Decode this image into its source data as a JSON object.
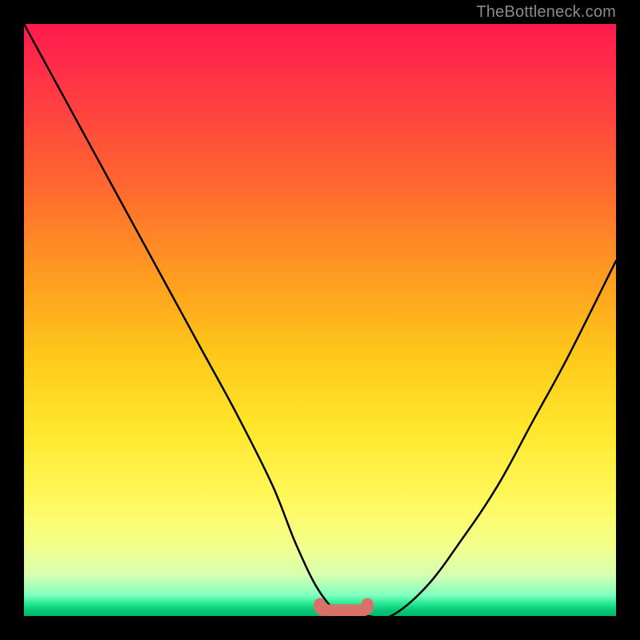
{
  "watermark": "TheBottleneck.com",
  "colors": {
    "curve_stroke": "#000000",
    "valley_stroke": "#d9716a",
    "background": "#000000"
  },
  "chart_data": {
    "type": "line",
    "title": "",
    "xlabel": "",
    "ylabel": "",
    "xlim": [
      0,
      100
    ],
    "ylim": [
      0,
      100
    ],
    "grid": false,
    "series": [
      {
        "name": "bottleneck-curve",
        "x": [
          0,
          6,
          12,
          18,
          24,
          30,
          36,
          42,
          46,
          50,
          54,
          58,
          62,
          68,
          74,
          80,
          86,
          92,
          100
        ],
        "values": [
          100,
          89,
          78,
          67,
          56,
          45,
          34,
          22,
          12,
          4,
          0,
          0,
          0,
          5,
          13,
          22,
          33,
          44,
          60
        ]
      }
    ],
    "annotations": [
      {
        "name": "valley-floor",
        "x_range": [
          50,
          58
        ],
        "y": 0
      }
    ]
  }
}
